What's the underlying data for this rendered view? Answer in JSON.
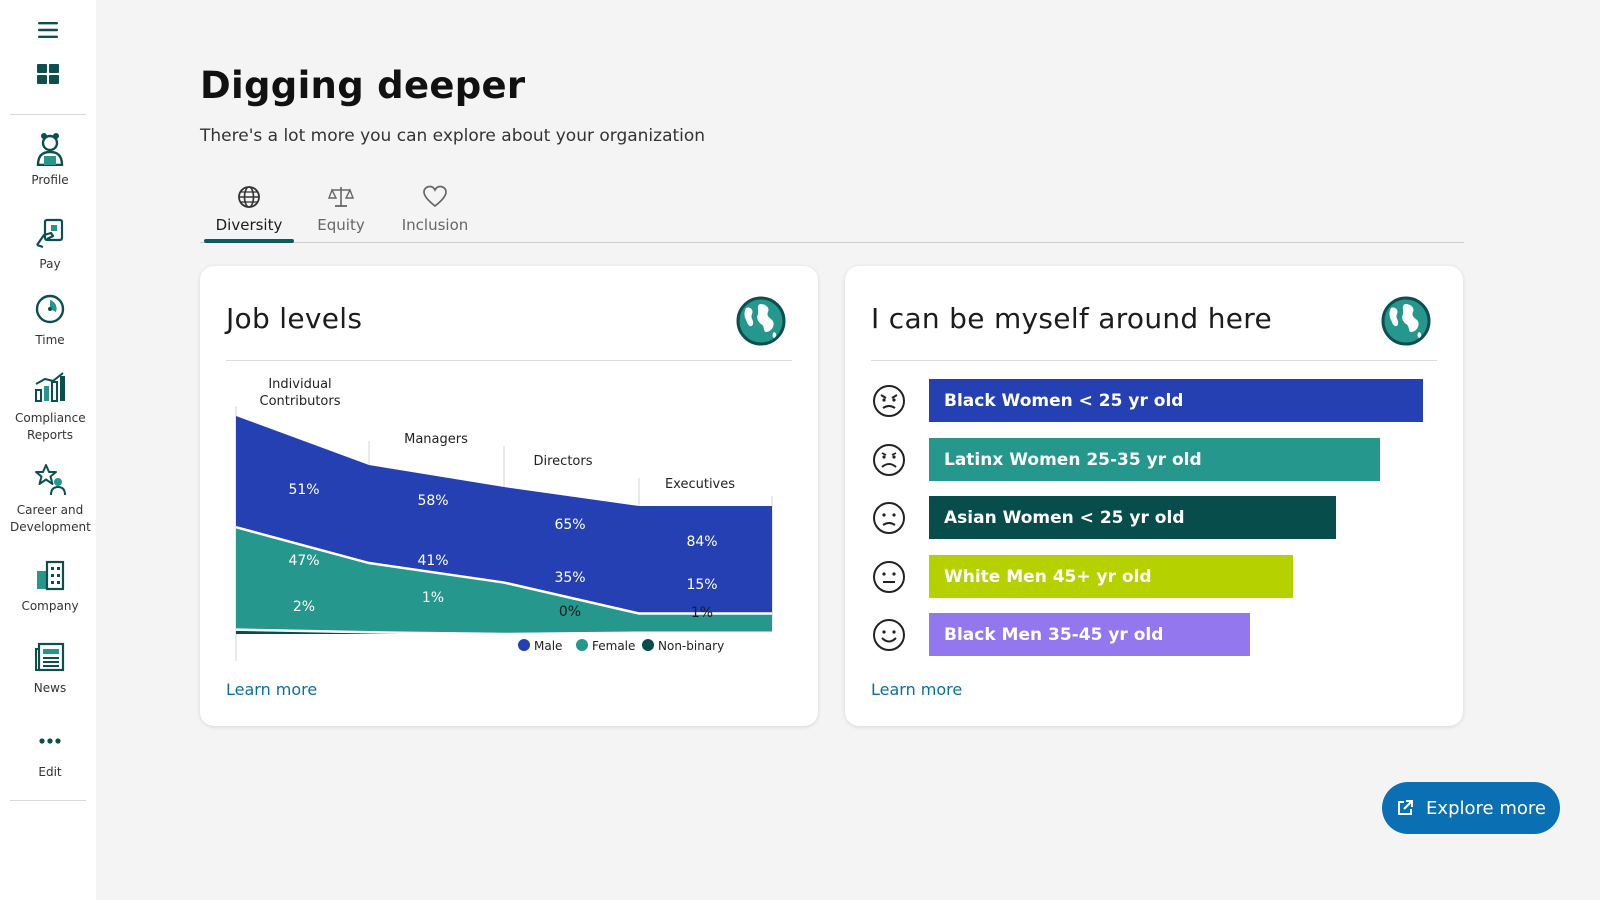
{
  "sidebar": {
    "items": [
      {
        "label": "Profile",
        "icon": "profile-icon"
      },
      {
        "label": "Pay",
        "icon": "pay-icon"
      },
      {
        "label": "Time",
        "icon": "clock-icon"
      },
      {
        "label": "Compliance Reports",
        "icon": "chart-icon"
      },
      {
        "label": "Career and Development",
        "icon": "star-person-icon"
      },
      {
        "label": "Company",
        "icon": "building-icon"
      },
      {
        "label": "News",
        "icon": "newspaper-icon"
      },
      {
        "label": "Edit",
        "icon": "more-dots-icon"
      }
    ]
  },
  "page": {
    "title": "Digging deeper",
    "subtitle": "There's a lot more you can explore about your organization"
  },
  "tabs": [
    {
      "label": "Diversity",
      "icon": "globe-icon",
      "active": true
    },
    {
      "label": "Equity",
      "icon": "scale-icon",
      "active": false
    },
    {
      "label": "Inclusion",
      "icon": "heart-icon",
      "active": false
    }
  ],
  "job_levels_card": {
    "title": "Job levels",
    "learn_more": "Learn more"
  },
  "myself_card": {
    "title": "I can be myself around here",
    "learn_more": "Learn more",
    "bars": [
      {
        "label": "Black Women < 25 yr old",
        "value": 0.925,
        "color": "#2440b3",
        "face": "angry-face-icon"
      },
      {
        "label": "Latinx Women 25-35 yr old",
        "value": 0.845,
        "color": "#25978c",
        "face": "sad-face-icon"
      },
      {
        "label": "Asian Women < 25 yr old",
        "value": 0.763,
        "color": "#074d4c",
        "face": "frown-face-icon"
      },
      {
        "label": "White Men 45+ yr old",
        "value": 0.681,
        "color": "#b5d100",
        "face": "neutral-face-icon"
      },
      {
        "label": "Black Men 35-45 yr old",
        "value": 0.601,
        "color": "#9277ef",
        "face": "smile-face-icon"
      }
    ]
  },
  "explore_button": {
    "label": "Explore more",
    "icon": "external-link-icon"
  },
  "colors": {
    "male": "#2440b3",
    "female": "#25978c",
    "nonbinary": "#074d4c",
    "accent": "#0a6fb3",
    "tab_underline": "#0d5c5c"
  },
  "chart_data": {
    "type": "area",
    "categories": [
      "Individual Contributors",
      "Managers",
      "Directors",
      "Executives"
    ],
    "series": [
      {
        "name": "Male",
        "values": [
          51,
          58,
          65,
          84
        ],
        "labels": [
          "51%",
          "58%",
          "65%",
          "84%"
        ]
      },
      {
        "name": "Female",
        "values": [
          47,
          41,
          35,
          15
        ],
        "labels": [
          "47%",
          "41%",
          "35%",
          "15%"
        ]
      },
      {
        "name": "Non-binary",
        "values": [
          2,
          1,
          0,
          1
        ],
        "labels": [
          "2%",
          "1%",
          "0%",
          "1%"
        ]
      }
    ],
    "legend": "bottom",
    "grid": false
  }
}
